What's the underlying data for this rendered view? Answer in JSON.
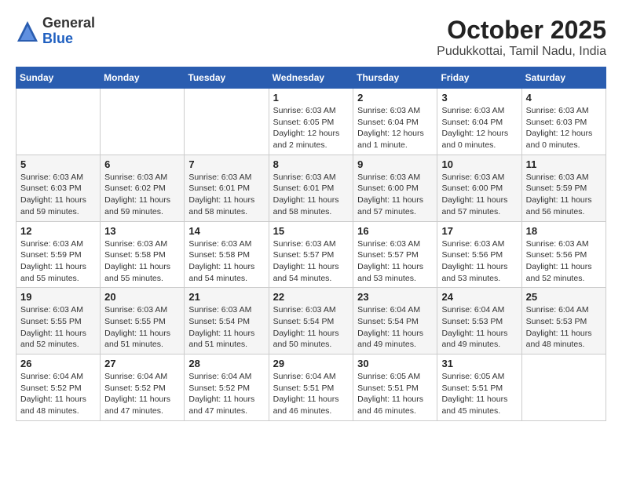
{
  "header": {
    "logo_general": "General",
    "logo_blue": "Blue",
    "month_title": "October 2025",
    "location": "Pudukkottai, Tamil Nadu, India"
  },
  "weekdays": [
    "Sunday",
    "Monday",
    "Tuesday",
    "Wednesday",
    "Thursday",
    "Friday",
    "Saturday"
  ],
  "weeks": [
    [
      {
        "day": "",
        "info": ""
      },
      {
        "day": "",
        "info": ""
      },
      {
        "day": "",
        "info": ""
      },
      {
        "day": "1",
        "info": "Sunrise: 6:03 AM\nSunset: 6:05 PM\nDaylight: 12 hours\nand 2 minutes."
      },
      {
        "day": "2",
        "info": "Sunrise: 6:03 AM\nSunset: 6:04 PM\nDaylight: 12 hours\nand 1 minute."
      },
      {
        "day": "3",
        "info": "Sunrise: 6:03 AM\nSunset: 6:04 PM\nDaylight: 12 hours\nand 0 minutes."
      },
      {
        "day": "4",
        "info": "Sunrise: 6:03 AM\nSunset: 6:03 PM\nDaylight: 12 hours\nand 0 minutes."
      }
    ],
    [
      {
        "day": "5",
        "info": "Sunrise: 6:03 AM\nSunset: 6:03 PM\nDaylight: 11 hours\nand 59 minutes."
      },
      {
        "day": "6",
        "info": "Sunrise: 6:03 AM\nSunset: 6:02 PM\nDaylight: 11 hours\nand 59 minutes."
      },
      {
        "day": "7",
        "info": "Sunrise: 6:03 AM\nSunset: 6:01 PM\nDaylight: 11 hours\nand 58 minutes."
      },
      {
        "day": "8",
        "info": "Sunrise: 6:03 AM\nSunset: 6:01 PM\nDaylight: 11 hours\nand 58 minutes."
      },
      {
        "day": "9",
        "info": "Sunrise: 6:03 AM\nSunset: 6:00 PM\nDaylight: 11 hours\nand 57 minutes."
      },
      {
        "day": "10",
        "info": "Sunrise: 6:03 AM\nSunset: 6:00 PM\nDaylight: 11 hours\nand 57 minutes."
      },
      {
        "day": "11",
        "info": "Sunrise: 6:03 AM\nSunset: 5:59 PM\nDaylight: 11 hours\nand 56 minutes."
      }
    ],
    [
      {
        "day": "12",
        "info": "Sunrise: 6:03 AM\nSunset: 5:59 PM\nDaylight: 11 hours\nand 55 minutes."
      },
      {
        "day": "13",
        "info": "Sunrise: 6:03 AM\nSunset: 5:58 PM\nDaylight: 11 hours\nand 55 minutes."
      },
      {
        "day": "14",
        "info": "Sunrise: 6:03 AM\nSunset: 5:58 PM\nDaylight: 11 hours\nand 54 minutes."
      },
      {
        "day": "15",
        "info": "Sunrise: 6:03 AM\nSunset: 5:57 PM\nDaylight: 11 hours\nand 54 minutes."
      },
      {
        "day": "16",
        "info": "Sunrise: 6:03 AM\nSunset: 5:57 PM\nDaylight: 11 hours\nand 53 minutes."
      },
      {
        "day": "17",
        "info": "Sunrise: 6:03 AM\nSunset: 5:56 PM\nDaylight: 11 hours\nand 53 minutes."
      },
      {
        "day": "18",
        "info": "Sunrise: 6:03 AM\nSunset: 5:56 PM\nDaylight: 11 hours\nand 52 minutes."
      }
    ],
    [
      {
        "day": "19",
        "info": "Sunrise: 6:03 AM\nSunset: 5:55 PM\nDaylight: 11 hours\nand 52 minutes."
      },
      {
        "day": "20",
        "info": "Sunrise: 6:03 AM\nSunset: 5:55 PM\nDaylight: 11 hours\nand 51 minutes."
      },
      {
        "day": "21",
        "info": "Sunrise: 6:03 AM\nSunset: 5:54 PM\nDaylight: 11 hours\nand 51 minutes."
      },
      {
        "day": "22",
        "info": "Sunrise: 6:03 AM\nSunset: 5:54 PM\nDaylight: 11 hours\nand 50 minutes."
      },
      {
        "day": "23",
        "info": "Sunrise: 6:04 AM\nSunset: 5:54 PM\nDaylight: 11 hours\nand 49 minutes."
      },
      {
        "day": "24",
        "info": "Sunrise: 6:04 AM\nSunset: 5:53 PM\nDaylight: 11 hours\nand 49 minutes."
      },
      {
        "day": "25",
        "info": "Sunrise: 6:04 AM\nSunset: 5:53 PM\nDaylight: 11 hours\nand 48 minutes."
      }
    ],
    [
      {
        "day": "26",
        "info": "Sunrise: 6:04 AM\nSunset: 5:52 PM\nDaylight: 11 hours\nand 48 minutes."
      },
      {
        "day": "27",
        "info": "Sunrise: 6:04 AM\nSunset: 5:52 PM\nDaylight: 11 hours\nand 47 minutes."
      },
      {
        "day": "28",
        "info": "Sunrise: 6:04 AM\nSunset: 5:52 PM\nDaylight: 11 hours\nand 47 minutes."
      },
      {
        "day": "29",
        "info": "Sunrise: 6:04 AM\nSunset: 5:51 PM\nDaylight: 11 hours\nand 46 minutes."
      },
      {
        "day": "30",
        "info": "Sunrise: 6:05 AM\nSunset: 5:51 PM\nDaylight: 11 hours\nand 46 minutes."
      },
      {
        "day": "31",
        "info": "Sunrise: 6:05 AM\nSunset: 5:51 PM\nDaylight: 11 hours\nand 45 minutes."
      },
      {
        "day": "",
        "info": ""
      }
    ]
  ]
}
